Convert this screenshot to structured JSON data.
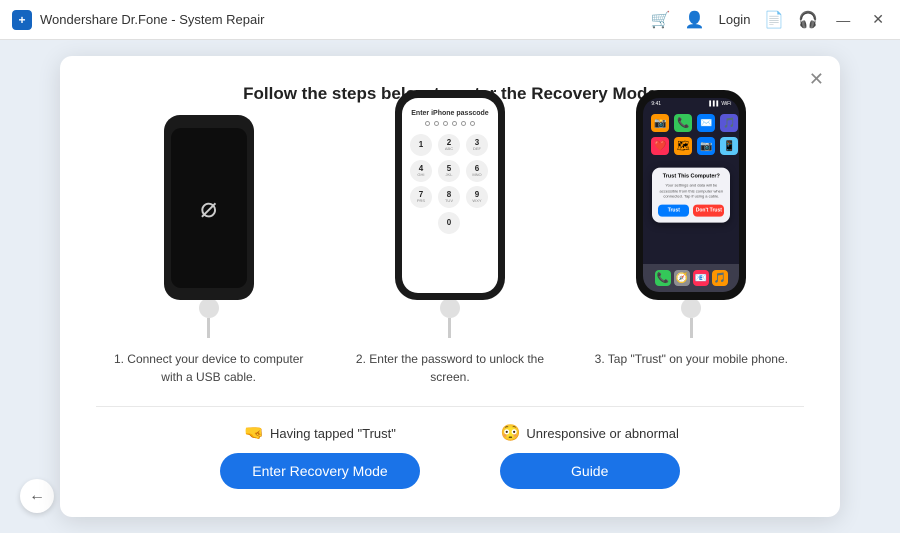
{
  "titlebar": {
    "app_name": "Wondershare Dr.Fone - System Repair",
    "login_label": "Login"
  },
  "dialog": {
    "title": "Follow the steps below to enter the Recovery Mode",
    "step1": {
      "label": "1. Connect your device to computer with a USB cable."
    },
    "step2": {
      "title": "Enter iPhone passcode",
      "label": "2. Enter the password to unlock the screen."
    },
    "step3": {
      "trust_title": "Trust This Computer?",
      "trust_body": "Your settings and data will be accessible from this computer when connected. Tap if using a cable.",
      "trust_label": "Trust",
      "dont_trust_label": "Don't Trust",
      "label": "3. Tap \"Trust\" on your mobile phone."
    },
    "option1": {
      "emoji": "🤜",
      "label": "Having tapped \"Trust\"",
      "button": "Enter Recovery Mode"
    },
    "option2": {
      "emoji": "😳",
      "label": "Unresponsive or abnormal",
      "button": "Guide"
    }
  },
  "back_button": "←"
}
